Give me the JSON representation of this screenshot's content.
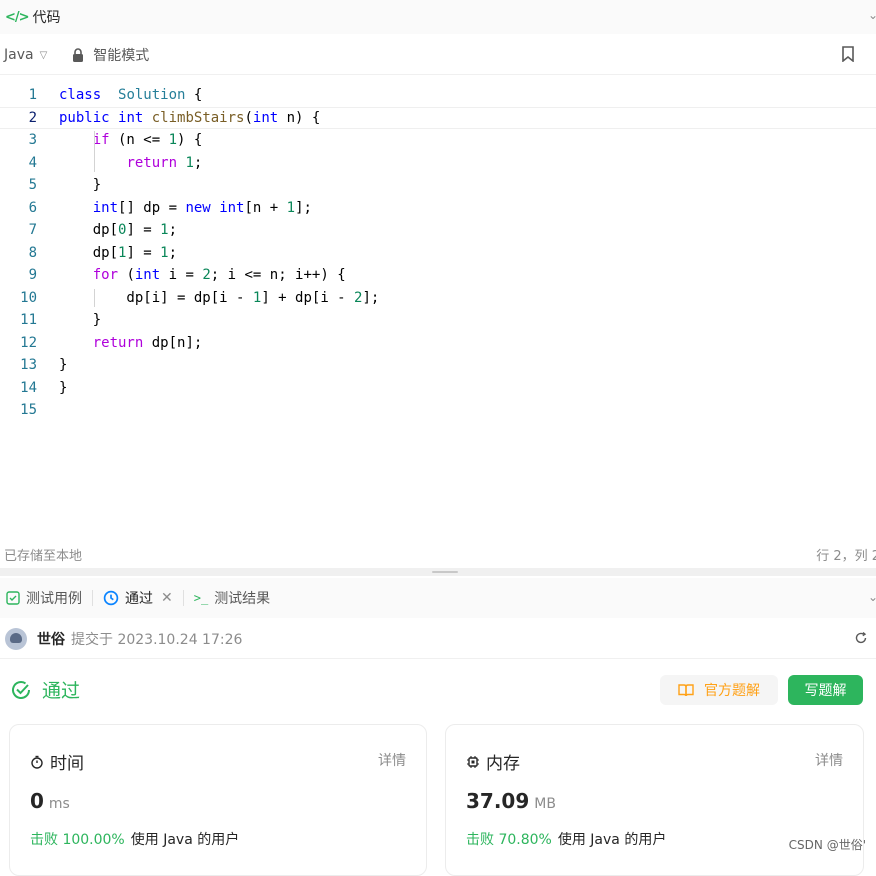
{
  "header": {
    "title": "代码"
  },
  "toolbar": {
    "language": "Java",
    "mode": "智能模式"
  },
  "editor": {
    "active_line": 2,
    "lines": [
      {
        "n": "1"
      },
      {
        "n": "2"
      },
      {
        "n": "3"
      },
      {
        "n": "4"
      },
      {
        "n": "5"
      },
      {
        "n": "6"
      },
      {
        "n": "7"
      },
      {
        "n": "8"
      },
      {
        "n": "9"
      },
      {
        "n": "10"
      },
      {
        "n": "11"
      },
      {
        "n": "12"
      },
      {
        "n": "13"
      },
      {
        "n": "14"
      },
      {
        "n": "15"
      }
    ],
    "code": [
      [
        [
          "kb",
          "class"
        ],
        [
          "",
          "  "
        ],
        [
          "ty",
          "Solution"
        ],
        [
          "",
          " {"
        ]
      ],
      [
        [
          "kb",
          "public"
        ],
        [
          "",
          " "
        ],
        [
          "kb",
          "int"
        ],
        [
          "",
          " "
        ],
        [
          "fn",
          "climbStairs"
        ],
        [
          "",
          "("
        ],
        [
          "kb",
          "int"
        ],
        [
          "",
          " n) {"
        ]
      ],
      [
        [
          "",
          "    "
        ],
        [
          "kw",
          "if"
        ],
        [
          "",
          " (n <= "
        ],
        [
          "nm",
          "1"
        ],
        [
          "",
          ") {"
        ]
      ],
      [
        [
          "",
          "        "
        ],
        [
          "kw",
          "return"
        ],
        [
          "",
          " "
        ],
        [
          "nm",
          "1"
        ],
        [
          "",
          ";"
        ]
      ],
      [
        [
          "",
          "    }"
        ]
      ],
      [
        [
          "",
          "    "
        ],
        [
          "kb",
          "int"
        ],
        [
          "",
          "[] dp = "
        ],
        [
          "kb",
          "new"
        ],
        [
          "",
          " "
        ],
        [
          "kb",
          "int"
        ],
        [
          "",
          "[n + "
        ],
        [
          "nm",
          "1"
        ],
        [
          "",
          "];"
        ]
      ],
      [
        [
          "",
          "    dp["
        ],
        [
          "nm",
          "0"
        ],
        [
          "",
          "] = "
        ],
        [
          "nm",
          "1"
        ],
        [
          "",
          ";"
        ]
      ],
      [
        [
          "",
          "    dp["
        ],
        [
          "nm",
          "1"
        ],
        [
          "",
          "] = "
        ],
        [
          "nm",
          "1"
        ],
        [
          "",
          ";"
        ]
      ],
      [
        [
          "",
          "    "
        ],
        [
          "kw",
          "for"
        ],
        [
          "",
          " ("
        ],
        [
          "kb",
          "int"
        ],
        [
          "",
          " i = "
        ],
        [
          "nm",
          "2"
        ],
        [
          "",
          "; i <= n; i++) {"
        ]
      ],
      [
        [
          "",
          "        dp[i] = dp[i - "
        ],
        [
          "nm",
          "1"
        ],
        [
          "",
          "] + dp[i - "
        ],
        [
          "nm",
          "2"
        ],
        [
          "",
          "];"
        ]
      ],
      [
        [
          "",
          "    }"
        ]
      ],
      [
        [
          "",
          "    "
        ],
        [
          "kw",
          "return"
        ],
        [
          "",
          " dp[n];"
        ]
      ],
      [
        [
          "",
          "}"
        ]
      ],
      [
        [
          "",
          "}"
        ]
      ],
      [
        [
          "",
          ""
        ]
      ]
    ]
  },
  "editor_footer": {
    "saved": "已存储至本地",
    "position": "行 2，列 2"
  },
  "tabs": {
    "testcase": "测试用例",
    "passed": "通过",
    "result": "测试结果"
  },
  "submission": {
    "user": "世俗",
    "submitted_at": "提交于 2023.10.24 17:26"
  },
  "status": {
    "label": "通过",
    "official_solution": "官方题解",
    "write_solution": "写题解"
  },
  "time_card": {
    "label": "时间",
    "detail": "详情",
    "value": "0",
    "unit": "ms",
    "beats": "击败 100.00%",
    "beats_suffix": "使用 Java 的用户"
  },
  "memory_card": {
    "label": "内存",
    "detail": "详情",
    "value": "37.09",
    "unit": "MB",
    "beats": "击败 70.80%",
    "beats_suffix": "使用 Java 的用户"
  },
  "watermark": "CSDN @世俗'",
  "colors": {
    "accent_green": "#2db55d",
    "accent_orange": "#ffa116"
  }
}
